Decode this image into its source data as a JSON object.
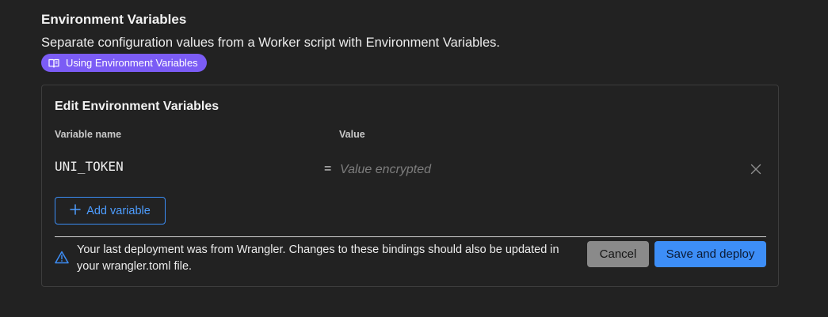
{
  "section": {
    "title": "Environment Variables",
    "description": "Separate configuration values from a Worker script with Environment Variables.",
    "doc_link_label": "Using Environment Variables",
    "doc_link_icon": "book-icon",
    "doc_link_color": "#7b5cf5"
  },
  "editor": {
    "title": "Edit Environment Variables",
    "columns": {
      "name": "Variable name",
      "value": "Value"
    },
    "rows": [
      {
        "name": "UNI_TOKEN",
        "separator": "=",
        "value": "",
        "value_placeholder": "Value encrypted",
        "remove_icon": "close-icon"
      }
    ],
    "add_label": "Add variable",
    "add_icon": "plus-icon"
  },
  "footer": {
    "warning_icon": "warning-icon",
    "warning": "Your last deployment was from Wrangler. Changes to these bindings should also be updated in your wrangler.toml file.",
    "cancel_label": "Cancel",
    "save_label": "Save and deploy",
    "accent_color": "#3d8ef7"
  }
}
